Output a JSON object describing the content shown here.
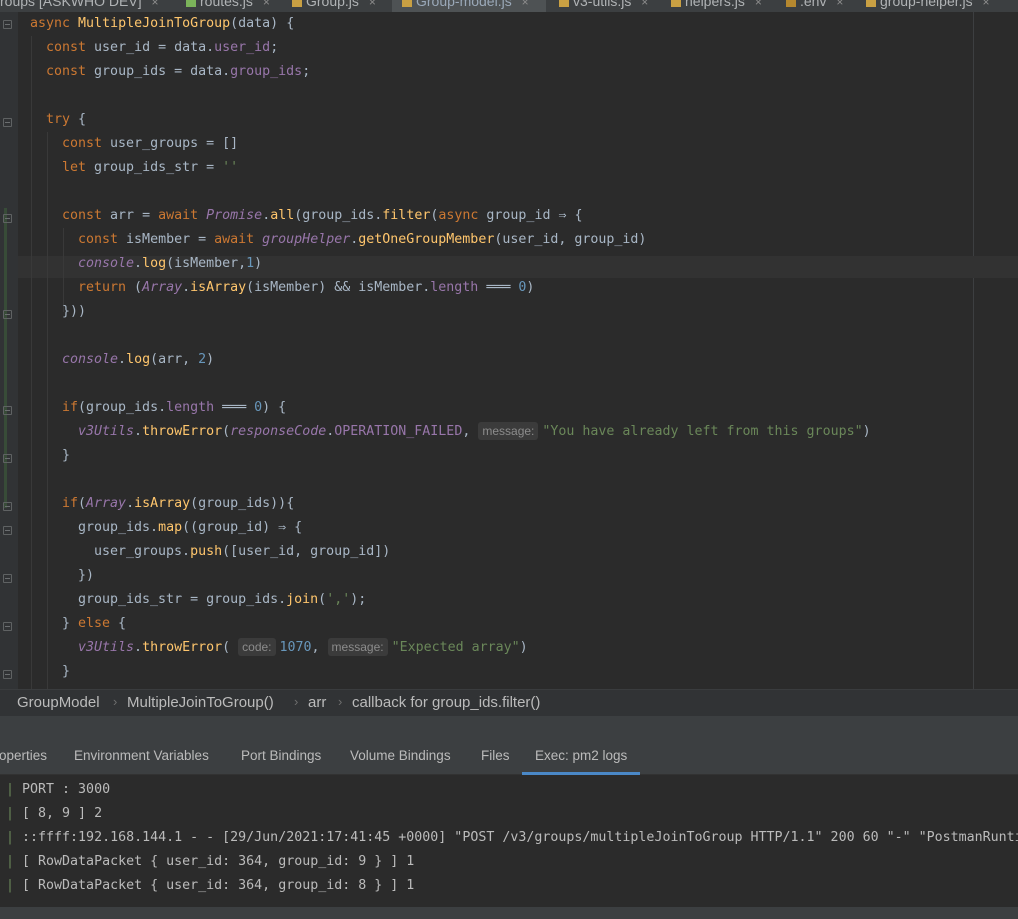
{
  "tabs": [
    {
      "label": "roups [ASKWHO DEV]",
      "active": false
    },
    {
      "label": "routes.js",
      "active": false
    },
    {
      "label": "Group.js",
      "active": false
    },
    {
      "label": "Group-model.js",
      "active": true
    },
    {
      "label": "v3-utils.js",
      "active": false
    },
    {
      "label": "helpers.js",
      "active": false
    },
    {
      "label": ".env",
      "active": false
    },
    {
      "label": "group-helper.js",
      "active": false
    }
  ],
  "tab_close": "×",
  "code": {
    "l1_kw": "async ",
    "l1_fn": "MultipleJoinToGroup",
    "l1_rest": "(data) {",
    "l2_kw": "const ",
    "l2_a": "user_id = data.",
    "l2_prop": "user_id",
    "l2_end": ";",
    "l3_kw": "const ",
    "l3_a": "group_ids = data.",
    "l3_prop": "group_ids",
    "l3_end": ";",
    "l5_kw": "try ",
    "l5_rest": "{",
    "l6_kw": "const ",
    "l6_rest": "user_groups = []",
    "l7_kw": "let ",
    "l7_a": "group_ids_str = ",
    "l7_str": "''",
    "l9_kw": "const ",
    "l9_a": "arr = ",
    "l9_kw2": "await ",
    "l9_pr": "Promise",
    "l9_b": ".",
    "l9_fn": "all",
    "l9_c": "(group_ids.",
    "l9_fn2": "filter",
    "l9_d": "(",
    "l9_kw3": "async ",
    "l9_e": "group_id ⇒ {",
    "l10_kw": "const ",
    "l10_a": "isMember = ",
    "l10_kw2": "await ",
    "l10_pr": "groupHelper",
    "l10_b": ".",
    "l10_fn": "getOneGroupMember",
    "l10_c": "(user_id, group_id)",
    "l11_pr": "console",
    "l11_b": ".",
    "l11_fn": "log",
    "l11_c": "(isMember,",
    "l11_num": "1",
    "l11_d": ")",
    "l12_kw": "return ",
    "l12_a": "(",
    "l12_pr": "Array",
    "l12_b": ".",
    "l12_fn": "isArray",
    "l12_c": "(isMember) && isMember.",
    "l12_prop": "length",
    "l12_d": " ═══ ",
    "l12_num": "0",
    "l12_e": ")",
    "l13": "}))",
    "l15_pr": "console",
    "l15_b": ".",
    "l15_fn": "log",
    "l15_c": "(arr, ",
    "l15_num": "2",
    "l15_d": ")",
    "l17_kw": "if",
    "l17_a": "(group_ids.",
    "l17_prop": "length",
    "l17_b": " ═══ ",
    "l17_num": "0",
    "l17_c": ") {",
    "l18_pr": "v3Utils",
    "l18_b": ".",
    "l18_fn": "throwError",
    "l18_c": "(",
    "l18_pr2": "responseCode",
    "l18_d": ".",
    "l18_prop": "OPERATION_FAILED",
    "l18_e": ", ",
    "l18_hint": "message:",
    "l18_str": "\"You have already left from this groups\"",
    "l18_f": ")",
    "l19": "}",
    "l21_kw": "if",
    "l21_a": "(",
    "l21_pr": "Array",
    "l21_b": ".",
    "l21_fn": "isArray",
    "l21_c": "(group_ids)){",
    "l22_a": "group_ids.",
    "l22_fn": "map",
    "l22_b": "((group_id) ⇒ {",
    "l23_a": "user_groups.",
    "l23_fn": "push",
    "l23_b": "([user_id, group_id])",
    "l24": "})",
    "l25_a": "group_ids_str = group_ids.",
    "l25_fn": "join",
    "l25_b": "(",
    "l25_str": "','",
    "l25_c": ");",
    "l26_a": "} ",
    "l26_kw": "else ",
    "l26_b": "{",
    "l27_pr": "v3Utils",
    "l27_b": ".",
    "l27_fn": "throwError",
    "l27_c": "( ",
    "l27_hint1": "code:",
    "l27_num": "1070",
    "l27_d": ", ",
    "l27_hint2": "message:",
    "l27_str": "\"Expected array\"",
    "l27_e": ")",
    "l28": "}"
  },
  "breadcrumb": [
    "GroupModel",
    "MultipleJoinToGroup()",
    "arr",
    "callback for group_ids.filter()"
  ],
  "breadcrumb_sep": "›",
  "panel_tabs": [
    "operties",
    "Environment Variables",
    "Port Bindings",
    "Volume Bindings",
    "Files",
    "Exec: pm2 logs"
  ],
  "terminal_bar": "|",
  "terminal": [
    "PORT : 3000",
    "[ 8, 9 ] 2",
    "::ffff:192.168.144.1 - - [29/Jun/2021:17:41:45 +0000] \"POST /v3/groups/multipleJoinToGroup HTTP/1.1\" 200 60 \"-\" \"PostmanRunti",
    "[ RowDataPacket { user_id: 364, group_id: 9 } ] 1",
    "[ RowDataPacket { user_id: 364, group_id: 8 } ] 1"
  ]
}
